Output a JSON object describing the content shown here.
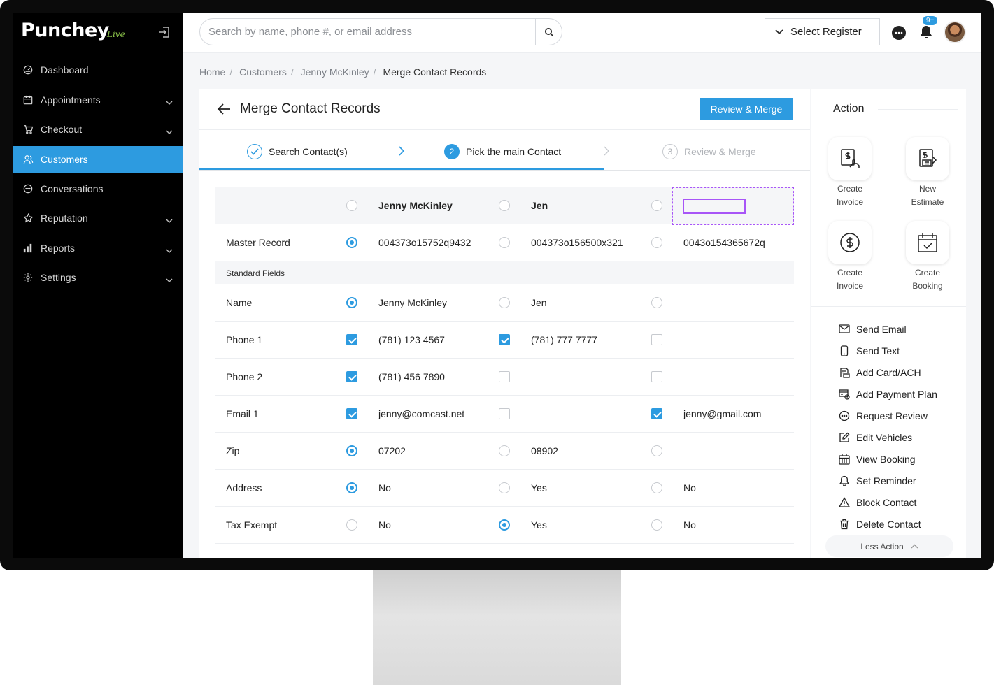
{
  "app": {
    "logo": "Punchey",
    "logo_suffix": "Live"
  },
  "sidebar": {
    "items": [
      {
        "label": "Dashboard",
        "icon": "dashboard-icon",
        "has_chevron": false,
        "active": false
      },
      {
        "label": "Appointments",
        "icon": "calendar-icon",
        "has_chevron": true,
        "active": false
      },
      {
        "label": "Checkout",
        "icon": "cart-icon",
        "has_chevron": true,
        "active": false
      },
      {
        "label": "Customers",
        "icon": "users-icon",
        "has_chevron": false,
        "active": true
      },
      {
        "label": "Conversations",
        "icon": "chat-icon",
        "has_chevron": false,
        "active": false
      },
      {
        "label": "Reputation",
        "icon": "star-icon",
        "has_chevron": true,
        "active": false
      },
      {
        "label": "Reports",
        "icon": "bar-chart-icon",
        "has_chevron": true,
        "active": false
      },
      {
        "label": "Settings",
        "icon": "gear-icon",
        "has_chevron": true,
        "active": false
      }
    ]
  },
  "topbar": {
    "search_placeholder": "Search by name, phone #, or email address",
    "register_label": "Select Register",
    "notification_badge": "9+"
  },
  "breadcrumb": [
    "Home",
    "Customers",
    "Jenny McKinley",
    "Merge Contact Records"
  ],
  "page": {
    "title": "Merge Contact Records",
    "primary_button": "Review & Merge",
    "steps": [
      {
        "num": "",
        "label": "Search Contact(s)",
        "state": "done"
      },
      {
        "num": "2",
        "label": "Pick the main Contact",
        "state": "active"
      },
      {
        "num": "3",
        "label": "Review & Merge",
        "state": "pending"
      }
    ]
  },
  "merge_table": {
    "columns": [
      "Jenny McKinley",
      "Jen",
      ""
    ],
    "rows": [
      {
        "label": "Master Record",
        "type": "radio",
        "selected": [
          true,
          false,
          false
        ],
        "values": [
          "004373o15752q9432",
          "004373o156500x321",
          "0043o154365672q"
        ]
      },
      {
        "section": "Standard Fields"
      },
      {
        "label": "Name",
        "type": "radio",
        "selected": [
          true,
          false,
          false
        ],
        "values": [
          "Jenny McKinley",
          "Jen",
          ""
        ]
      },
      {
        "label": "Phone 1",
        "type": "check",
        "selected": [
          true,
          true,
          false
        ],
        "values": [
          "(781) 123 4567",
          "(781) 777 7777",
          ""
        ]
      },
      {
        "label": "Phone 2",
        "type": "check",
        "selected": [
          true,
          false,
          false
        ],
        "values": [
          "(781) 456 7890",
          "",
          ""
        ]
      },
      {
        "label": "Email 1",
        "type": "check",
        "selected": [
          true,
          false,
          true
        ],
        "values": [
          "jenny@comcast.net",
          "",
          "jenny@gmail.com"
        ]
      },
      {
        "label": "Zip",
        "type": "radio",
        "selected": [
          true,
          false,
          false
        ],
        "values": [
          "07202",
          " 08902",
          ""
        ]
      },
      {
        "label": "Address",
        "type": "radio",
        "selected": [
          true,
          false,
          false
        ],
        "values": [
          "No",
          "Yes",
          "No"
        ]
      },
      {
        "label": "Tax Exempt",
        "type": "radio",
        "selected": [
          false,
          true,
          false
        ],
        "values": [
          "No",
          "Yes",
          "No"
        ]
      }
    ]
  },
  "action_panel": {
    "title": "Action",
    "tiles": [
      {
        "line1": "Create",
        "line2": "Invoice",
        "icon": "invoice-hand-icon"
      },
      {
        "line1": "New",
        "line2": "Estimate",
        "icon": "estimate-icon"
      },
      {
        "line1": "Create",
        "line2": "Invoice",
        "icon": "dollar-circle-icon"
      },
      {
        "line1": "Create",
        "line2": "Booking",
        "icon": "calendar-check-icon"
      }
    ],
    "list": [
      {
        "label": "Send Email",
        "icon": "mail-icon"
      },
      {
        "label": "Send Text",
        "icon": "phone-icon"
      },
      {
        "label": "Add Card/ACH",
        "icon": "card-icon"
      },
      {
        "label": "Add Payment Plan",
        "icon": "payment-plan-icon"
      },
      {
        "label": "Request Review",
        "icon": "review-bubble-icon"
      },
      {
        "label": "Edit Vehicles",
        "icon": "edit-icon"
      },
      {
        "label": "View Booking",
        "icon": "calendar-grid-icon"
      },
      {
        "label": "Set Reminder",
        "icon": "bell-icon"
      },
      {
        "label": "Block Contact",
        "icon": "warning-icon"
      },
      {
        "label": "Delete Contact",
        "icon": "trash-icon"
      }
    ],
    "less_label": "Less Action"
  },
  "colors": {
    "accent": "#2d9be0",
    "sidebar_bg": "#000000",
    "selection_outline": "#a855f7"
  }
}
